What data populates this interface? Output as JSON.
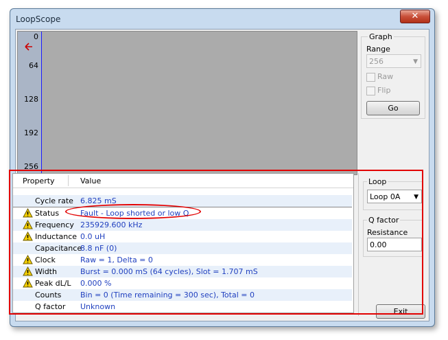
{
  "window": {
    "title": "LoopScope",
    "close_glyph": "✕"
  },
  "graph": {
    "ticks": [
      "0",
      "64",
      "128",
      "192",
      "256"
    ],
    "marker_icon": "arrow-left-icon",
    "marker_glyph": "✚"
  },
  "graph_group": {
    "legend": "Graph",
    "range_label": "Range",
    "range_value": "256",
    "raw_label": "Raw",
    "flip_label": "Flip",
    "go_label": "Go"
  },
  "table": {
    "headers": [
      "Property",
      "Value"
    ],
    "rows": [
      {
        "property": "Cycle rate",
        "value": "6.825 mS",
        "warn": false
      },
      {
        "property": "Status",
        "value": "Fault - Loop shorted or low Q",
        "warn": true
      },
      {
        "property": "Frequency",
        "value": "235929.600 kHz",
        "warn": true
      },
      {
        "property": "Inductance",
        "value": "0.0 uH",
        "warn": true
      },
      {
        "property": "Capacitance",
        "value": "8.8 nF (0)",
        "warn": false
      },
      {
        "property": "Clock",
        "value": "Raw = 1, Delta = 0",
        "warn": true
      },
      {
        "property": "Width",
        "value": "Burst = 0.000 mS (64 cycles), Slot = 1.707 mS",
        "warn": true
      },
      {
        "property": "Peak dL/L",
        "value": "0.000 %",
        "warn": true
      },
      {
        "property": "Counts",
        "value": "Bin = 0 (Time remaining = 300 sec), Total = 0",
        "warn": false
      },
      {
        "property": "Q factor",
        "value": "Unknown",
        "warn": false
      }
    ]
  },
  "loop_group": {
    "legend": "Loop",
    "selected": "Loop 0A"
  },
  "q_group": {
    "legend": "Q factor",
    "resistance_label": "Resistance",
    "resistance_value": "0.00"
  },
  "exit_label": "Exit",
  "colors": {
    "value_text": "#1f3fbf",
    "highlight": "#e20000",
    "axis_line": "#1a1aff"
  }
}
